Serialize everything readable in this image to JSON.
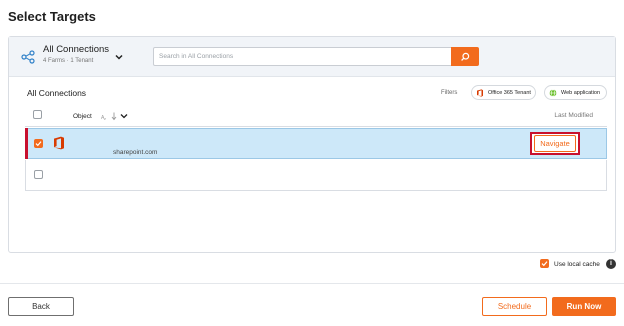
{
  "page": {
    "title": "Select Targets"
  },
  "connections": {
    "title": "All Connections",
    "subtitle": "4 Farms · 1 Tenant",
    "search_placeholder": "Search in All Connections"
  },
  "list": {
    "title": "All Connections",
    "filters_label": "Filters",
    "filters": [
      {
        "label": "Office 365 Tenant",
        "icon": "office-365-icon"
      },
      {
        "label": "Web application",
        "icon": "globe-icon"
      }
    ],
    "columns": {
      "object": "Object",
      "last_modified": "Last Modified"
    },
    "rows": [
      {
        "url": "sharepoint.com",
        "selected": true,
        "action": "Navigate"
      }
    ]
  },
  "options": {
    "use_local_cache_label": "Use local cache",
    "use_local_cache": true
  },
  "footer": {
    "back": "Back",
    "schedule": "Schedule",
    "run_now": "Run Now"
  },
  "colors": {
    "accent": "#f26b1d",
    "highlight": "#c8102e",
    "selected_row": "#cde8f9"
  }
}
